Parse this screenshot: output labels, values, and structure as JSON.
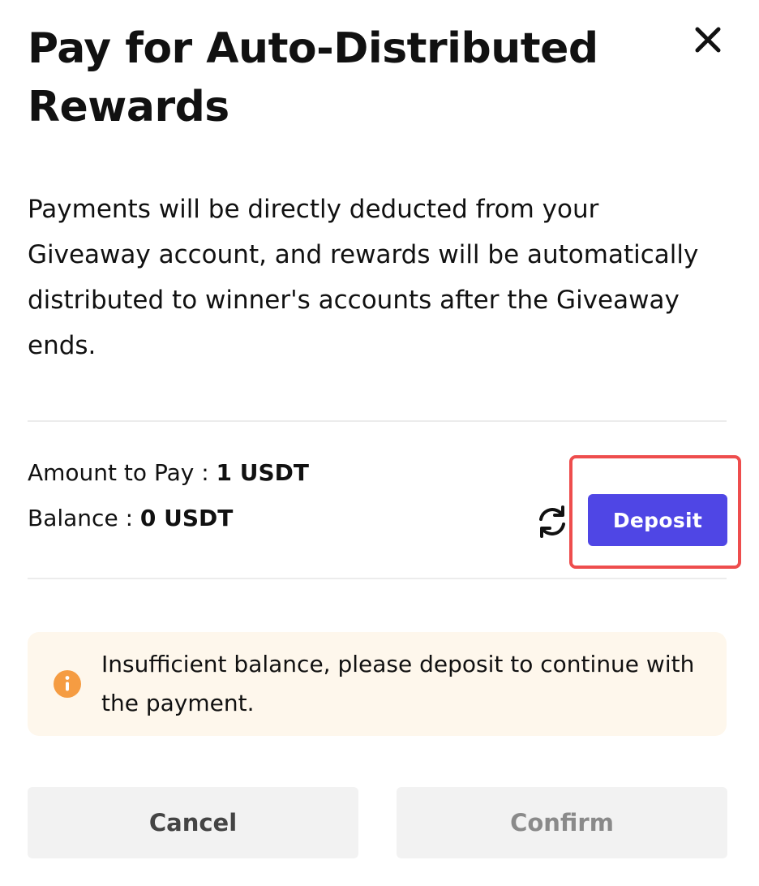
{
  "dialog": {
    "title": "Pay for Auto-Distributed Rewards",
    "description": "Payments will be directly deducted from your Giveaway account, and rewards will be automatically distributed to winner's accounts after the Giveaway ends.",
    "close_icon": "close-icon"
  },
  "payment": {
    "amount_label": "Amount to Pay : ",
    "amount_value": "1 USDT",
    "balance_label": "Balance : ",
    "balance_value": "0 USDT",
    "refresh_icon": "refresh-icon",
    "deposit_label": "Deposit"
  },
  "alert": {
    "icon": "info-icon",
    "text": "Insufficient balance, please deposit to continue with the payment."
  },
  "actions": {
    "cancel_label": "Cancel",
    "confirm_label": "Confirm"
  },
  "colors": {
    "accent": "#4f46e5",
    "highlight": "#ee4d4d",
    "warning": "#f59c42",
    "alert_bg": "#fef7ec",
    "button_bg": "#f2f2f2"
  }
}
